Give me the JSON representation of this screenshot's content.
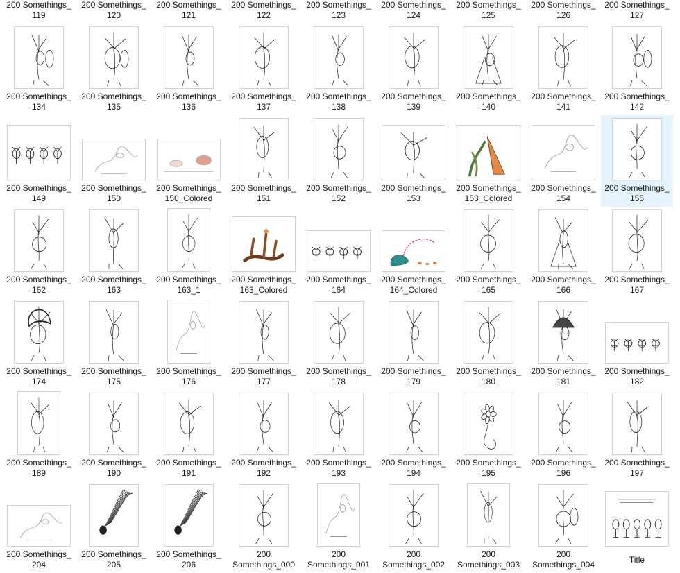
{
  "rows": [
    {
      "files": [
        {
          "l1": "200 Somethings_",
          "l2": "119",
          "art": "none"
        },
        {
          "l1": "200 Somethings_",
          "l2": "120",
          "art": "none"
        },
        {
          "l1": "200 Somethings_",
          "l2": "121",
          "art": "none"
        },
        {
          "l1": "200 Somethings_",
          "l2": "122",
          "art": "none"
        },
        {
          "l1": "200 Somethings_",
          "l2": "123",
          "art": "none"
        },
        {
          "l1": "200 Somethings_",
          "l2": "124",
          "art": "none"
        },
        {
          "l1": "200 Somethings_",
          "l2": "125",
          "art": "none"
        },
        {
          "l1": "200 Somethings_",
          "l2": "126",
          "art": "none"
        },
        {
          "l1": "200 Somethings_",
          "l2": "127",
          "art": "none"
        }
      ]
    },
    {
      "files": [
        {
          "l1": "200 Somethings_",
          "l2": "134",
          "art": "figures",
          "shape": "portrait"
        },
        {
          "l1": "200 Somethings_",
          "l2": "135",
          "art": "figures",
          "shape": "portrait"
        },
        {
          "l1": "200 Somethings_",
          "l2": "136",
          "art": "creature",
          "shape": "portrait"
        },
        {
          "l1": "200 Somethings_",
          "l2": "137",
          "art": "tree",
          "shape": "portrait"
        },
        {
          "l1": "200 Somethings_",
          "l2": "138",
          "art": "tree",
          "shape": "portrait"
        },
        {
          "l1": "200 Somethings_",
          "l2": "139",
          "art": "creature",
          "shape": "portrait"
        },
        {
          "l1": "200 Somethings_",
          "l2": "140",
          "art": "dress",
          "shape": "portrait"
        },
        {
          "l1": "200 Somethings_",
          "l2": "141",
          "art": "creature",
          "shape": "portrait"
        },
        {
          "l1": "200 Somethings_",
          "l2": "142",
          "art": "figures",
          "shape": "portrait"
        }
      ]
    },
    {
      "files": [
        {
          "l1": "200 Somethings_",
          "l2": "149",
          "art": "herd",
          "shape": "landscape"
        },
        {
          "l1": "200 Somethings_",
          "l2": "150",
          "art": "faint",
          "shape": "wide"
        },
        {
          "l1": "200 Somethings_",
          "l2": "150_Colored",
          "art": "colorsoft",
          "shape": "wide"
        },
        {
          "l1": "200 Somethings_",
          "l2": "151",
          "art": "creature",
          "shape": "portrait"
        },
        {
          "l1": "200 Somethings_",
          "l2": "152",
          "art": "tree",
          "shape": "portrait"
        },
        {
          "l1": "200 Somethings_",
          "l2": "153",
          "art": "tree",
          "shape": "landscape"
        },
        {
          "l1": "200 Somethings_",
          "l2": "153_Colored",
          "art": "colororange",
          "shape": "landscape"
        },
        {
          "l1": "200 Somethings_",
          "l2": "154",
          "art": "faint",
          "shape": "landscape"
        },
        {
          "l1": "200 Somethings_",
          "l2": "155",
          "art": "creature",
          "shape": "portrait"
        }
      ]
    },
    {
      "files": [
        {
          "l1": "200 Somethings_",
          "l2": "162",
          "art": "tree",
          "shape": "portrait"
        },
        {
          "l1": "200 Somethings_",
          "l2": "163",
          "art": "creature",
          "shape": "portrait"
        },
        {
          "l1": "200 Somethings_",
          "l2": "163_1",
          "art": "tree",
          "shape": "slim"
        },
        {
          "l1": "200 Somethings_",
          "l2": "163_Colored",
          "art": "colorbrown",
          "shape": "landscape"
        },
        {
          "l1": "200 Somethings_",
          "l2": "164",
          "art": "herd",
          "shape": "wide"
        },
        {
          "l1": "200 Somethings_",
          "l2": "164_Colored",
          "art": "colorteal",
          "shape": "wide"
        },
        {
          "l1": "200 Somethings_",
          "l2": "165",
          "art": "tree",
          "shape": "portrait"
        },
        {
          "l1": "200 Somethings_",
          "l2": "166",
          "art": "dress",
          "shape": "portrait"
        },
        {
          "l1": "200 Somethings_",
          "l2": "167",
          "art": "creature",
          "shape": "portrait"
        }
      ]
    },
    {
      "files": [
        {
          "l1": "200 Somethings_",
          "l2": "174",
          "art": "hair",
          "shape": "portrait"
        },
        {
          "l1": "200 Somethings_",
          "l2": "175",
          "art": "creature",
          "shape": "portrait"
        },
        {
          "l1": "200 Somethings_",
          "l2": "176",
          "art": "faint",
          "shape": "slim"
        },
        {
          "l1": "200 Somethings_",
          "l2": "177",
          "art": "tree",
          "shape": "portrait"
        },
        {
          "l1": "200 Somethings_",
          "l2": "178",
          "art": "tree",
          "shape": "portrait"
        },
        {
          "l1": "200 Somethings_",
          "l2": "179",
          "art": "creature",
          "shape": "portrait"
        },
        {
          "l1": "200 Somethings_",
          "l2": "180",
          "art": "tree",
          "shape": "portrait"
        },
        {
          "l1": "200 Somethings_",
          "l2": "181",
          "art": "mushroom",
          "shape": "portrait"
        },
        {
          "l1": "200 Somethings_",
          "l2": "182",
          "art": "herd",
          "shape": "wide"
        }
      ]
    },
    {
      "files": [
        {
          "l1": "200 Somethings_",
          "l2": "189",
          "art": "creature",
          "shape": "slim"
        },
        {
          "l1": "200 Somethings_",
          "l2": "190",
          "art": "creature",
          "shape": "portrait"
        },
        {
          "l1": "200 Somethings_",
          "l2": "191",
          "art": "creature",
          "shape": "portrait"
        },
        {
          "l1": "200 Somethings_",
          "l2": "192",
          "art": "creature",
          "shape": "portrait"
        },
        {
          "l1": "200 Somethings_",
          "l2": "193",
          "art": "creature",
          "shape": "portrait"
        },
        {
          "l1": "200 Somethings_",
          "l2": "194",
          "art": "creature",
          "shape": "portrait"
        },
        {
          "l1": "200 Somethings_",
          "l2": "195",
          "art": "flower",
          "shape": "portrait"
        },
        {
          "l1": "200 Somethings_",
          "l2": "196",
          "art": "creature",
          "shape": "portrait"
        },
        {
          "l1": "200 Somethings_",
          "l2": "197",
          "art": "creature",
          "shape": "portrait"
        }
      ]
    },
    {
      "files": [
        {
          "l1": "200 Somethings_",
          "l2": "204",
          "art": "faint",
          "shape": "wide"
        },
        {
          "l1": "200 Somethings_",
          "l2": "205",
          "art": "comet",
          "shape": "portrait"
        },
        {
          "l1": "200 Somethings_",
          "l2": "206",
          "art": "comet",
          "shape": "portrait"
        },
        {
          "l1": "200",
          "l2": "Somethings_000",
          "art": "creature",
          "shape": "portrait"
        },
        {
          "l1": "200",
          "l2": "Somethings_001",
          "art": "faint",
          "shape": "slim"
        },
        {
          "l1": "200",
          "l2": "Somethings_002",
          "art": "creature",
          "shape": "portrait"
        },
        {
          "l1": "200",
          "l2": "Somethings_003",
          "art": "creature",
          "shape": "slim"
        },
        {
          "l1": "200",
          "l2": "Somethings_004",
          "art": "figures",
          "shape": "portrait"
        },
        {
          "l1": "",
          "l2": "Title",
          "art": "title",
          "shape": "landscape"
        }
      ]
    }
  ],
  "selected": {
    "row": 2,
    "col": 8
  }
}
